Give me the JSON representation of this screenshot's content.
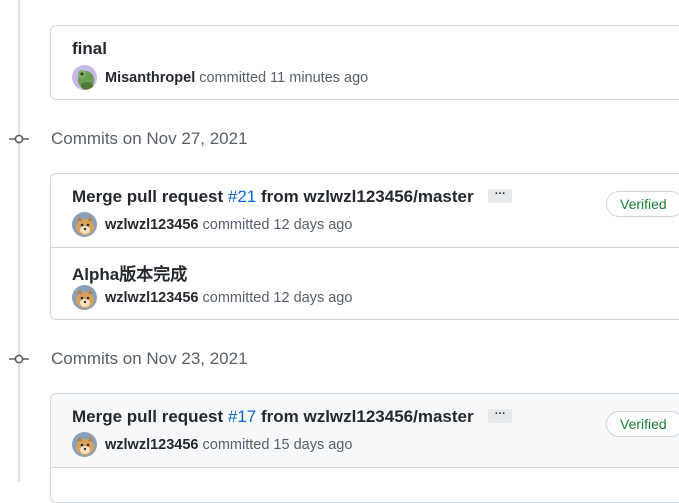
{
  "groups": [
    {
      "commits": [
        {
          "title": "final",
          "author": "Misanthropel",
          "action": "committed",
          "time": "11 minutes ago"
        }
      ]
    },
    {
      "heading": "Commits on Nov 27, 2021",
      "commits": [
        {
          "title_prefix": "Merge pull request",
          "pr": "#21",
          "title_suffix": "from wzlwzl123456/master",
          "author": "wzlwzl123456",
          "action": "committed",
          "time": "12 days ago",
          "badge": "Verified"
        },
        {
          "title": "Alpha版本完成",
          "author": "wzlwzl123456",
          "action": "committed",
          "time": "12 days ago"
        }
      ]
    },
    {
      "heading": "Commits on Nov 23, 2021",
      "commits": [
        {
          "title_prefix": "Merge pull request",
          "pr": "#17",
          "title_suffix": "from wzlwzl123456/master",
          "author": "wzlwzl123456",
          "action": "committed",
          "time": "15 days ago",
          "badge": "Verified"
        }
      ]
    }
  ],
  "ellipsis_label": "···",
  "colors": {
    "link": "#0969da",
    "verified": "#1a7f37",
    "muted": "#57606a",
    "border": "#d0d7de"
  },
  "icons": {
    "timeline": "git-commit-icon",
    "avatar_misanthropel": "frog-avatar",
    "avatar_wzl": "dog-avatar"
  }
}
